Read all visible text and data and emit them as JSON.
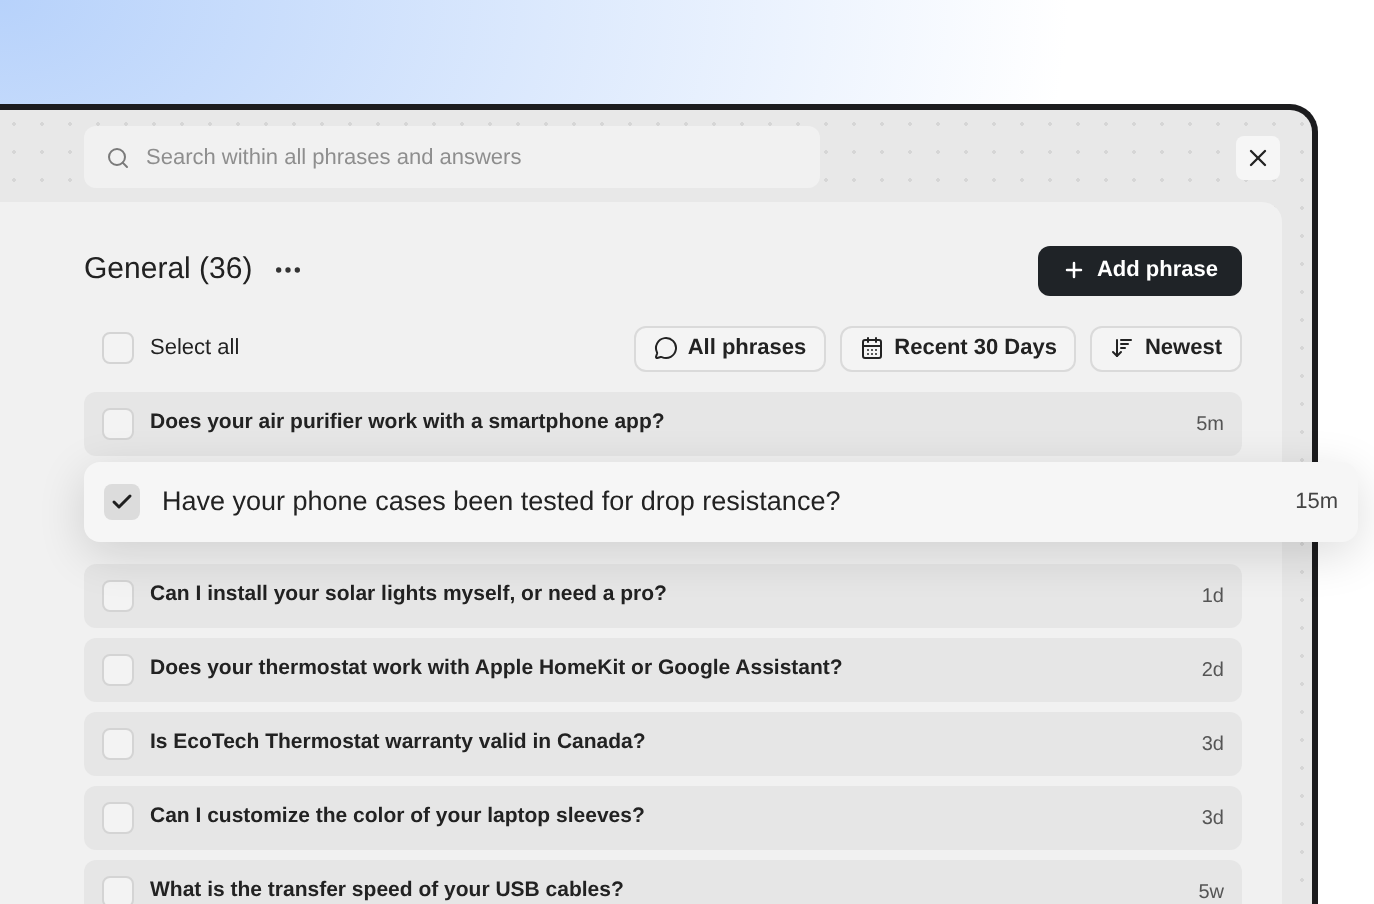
{
  "search": {
    "placeholder": "Search within all phrases and answers"
  },
  "header": {
    "title": "General (36)",
    "add_button": "Add phrase"
  },
  "select_all": {
    "label": "Select all",
    "checked": false
  },
  "filters": [
    {
      "kind": "chat",
      "label": "All phrases"
    },
    {
      "kind": "calendar",
      "label": "Recent 30 Days"
    },
    {
      "kind": "sort",
      "label": "Newest"
    }
  ],
  "phrases": [
    {
      "text": "Does your air purifier work with a smartphone app?",
      "age": "5m",
      "selected": false
    },
    {
      "text": "Have your phone cases been tested for drop resistance?",
      "age": "15m",
      "selected": true
    },
    {
      "text": "Can I install your solar lights myself, or need a pro?",
      "age": "1d",
      "selected": false
    },
    {
      "text": "Does your thermostat work with Apple HomeKit or Google Assistant?",
      "age": "2d",
      "selected": false
    },
    {
      "text": "Is EcoTech Thermostat warranty valid in Canada?",
      "age": "3d",
      "selected": false
    },
    {
      "text": "Can I customize the color of your laptop sleeves?",
      "age": "3d",
      "selected": false
    },
    {
      "text": "What is the transfer speed of your USB cables?",
      "age": "5w",
      "selected": false
    }
  ]
}
